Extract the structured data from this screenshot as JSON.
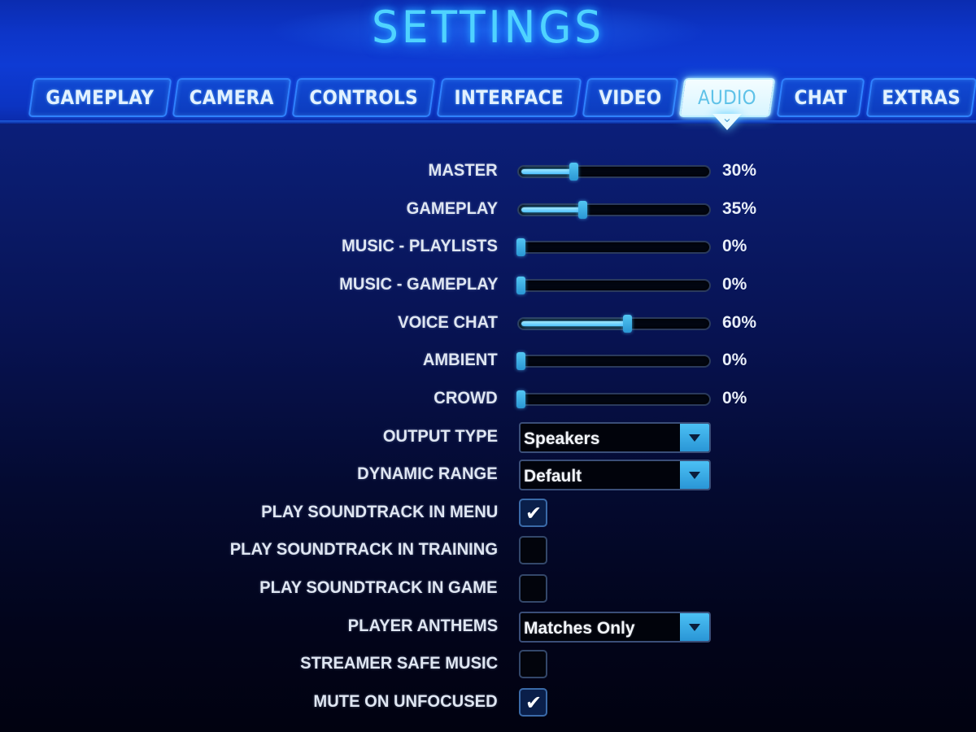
{
  "header": {
    "title": "SETTINGS"
  },
  "tabs": [
    {
      "label": "GAMEPLAY",
      "active": false
    },
    {
      "label": "CAMERA",
      "active": false
    },
    {
      "label": "CONTROLS",
      "active": false
    },
    {
      "label": "INTERFACE",
      "active": false
    },
    {
      "label": "VIDEO",
      "active": false
    },
    {
      "label": "AUDIO",
      "active": true
    },
    {
      "label": "CHAT",
      "active": false
    },
    {
      "label": "EXTRAS",
      "active": false
    }
  ],
  "sliders": [
    {
      "label": "MASTER",
      "value": 30,
      "display": "30%"
    },
    {
      "label": "GAMEPLAY",
      "value": 35,
      "display": "35%"
    },
    {
      "label": "MUSIC - PLAYLISTS",
      "value": 0,
      "display": "0%"
    },
    {
      "label": "MUSIC - GAMEPLAY",
      "value": 0,
      "display": "0%"
    },
    {
      "label": "VOICE CHAT",
      "value": 60,
      "display": "60%"
    },
    {
      "label": "AMBIENT",
      "value": 0,
      "display": "0%"
    },
    {
      "label": "CROWD",
      "value": 0,
      "display": "0%"
    }
  ],
  "dropdowns": {
    "output_type": {
      "label": "OUTPUT TYPE",
      "value": "Speakers"
    },
    "dynamic_range": {
      "label": "DYNAMIC RANGE",
      "value": "Default"
    },
    "player_anthems": {
      "label": "PLAYER ANTHEMS",
      "value": "Matches Only"
    }
  },
  "checkboxes": {
    "soundtrack_menu": {
      "label": "PLAY SOUNDTRACK IN MENU",
      "checked": true
    },
    "soundtrack_training": {
      "label": "PLAY SOUNDTRACK IN TRAINING",
      "checked": false
    },
    "soundtrack_game": {
      "label": "PLAY SOUNDTRACK IN GAME",
      "checked": false
    },
    "streamer_safe": {
      "label": "STREAMER SAFE MUSIC",
      "checked": false
    },
    "mute_unfocused": {
      "label": "MUTE ON UNFOCUSED",
      "checked": true
    }
  },
  "icons": {
    "checkmark": "✔",
    "tab_pointer_chevron": "⌄"
  },
  "colors": {
    "accent": "#4fc2ff",
    "title_glow": "#4fd3ff",
    "header_blue": "#0e3bd4",
    "tab_border": "#2f82ff"
  }
}
